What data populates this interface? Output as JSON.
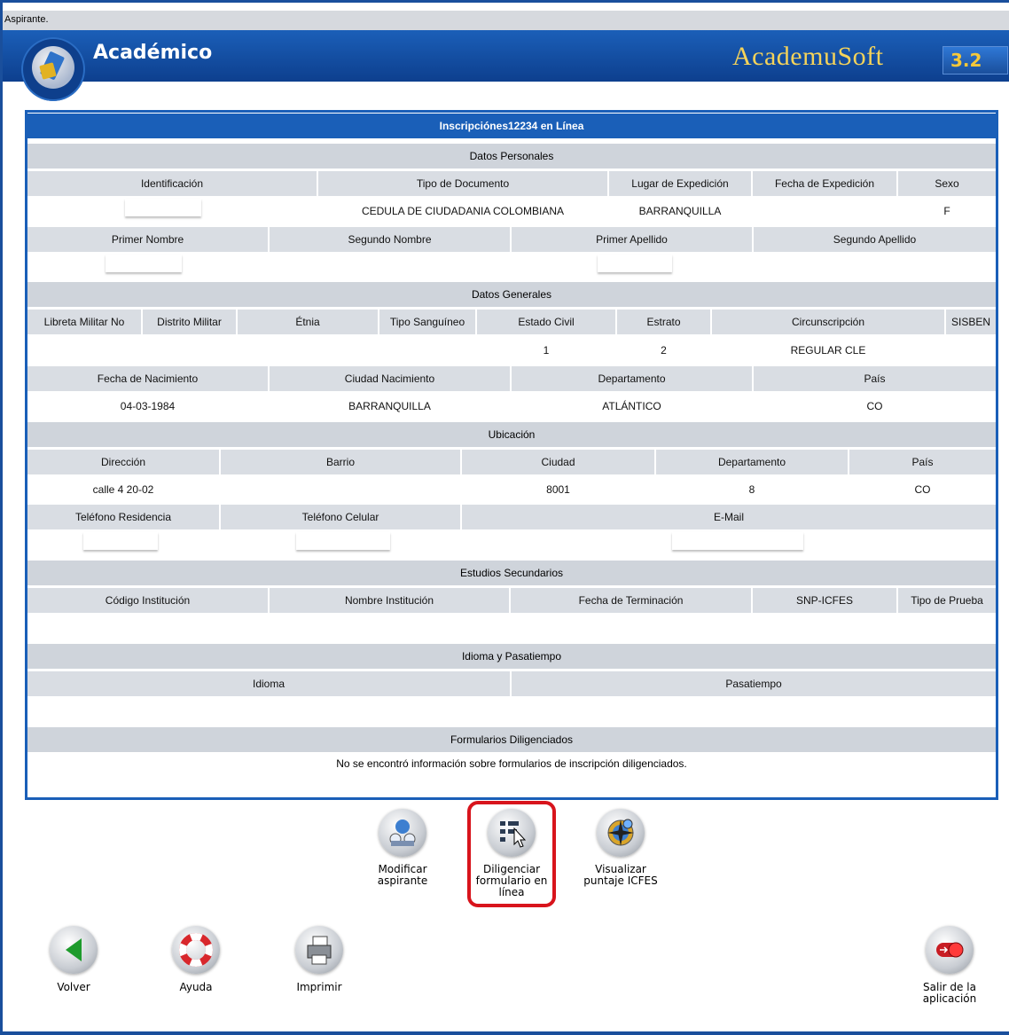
{
  "window": {
    "status_label": "Aspirante."
  },
  "header": {
    "title": "Académico",
    "brand": "AcademuSoft",
    "brand_version": "3.2"
  },
  "panel": {
    "title": "Inscripciónes12234 en Línea",
    "personal": {
      "section": "Datos Personales",
      "h1": [
        "Identificación",
        "Tipo de Documento",
        "Lugar de Expedición",
        "Fecha de Expedición",
        "Sexo"
      ],
      "v1": [
        "",
        "CEDULA DE CIUDADANIA COLOMBIANA",
        "BARRANQUILLA",
        "",
        "F"
      ],
      "h2": [
        "Primer Nombre",
        "Segundo Nombre",
        "Primer Apellido",
        "Segundo Apellido"
      ]
    },
    "general": {
      "section": "Datos Generales",
      "h1": [
        "Libreta Militar No",
        "Distrito Militar",
        "Étnia",
        "Tipo Sanguíneo",
        "Estado Civil",
        "Estrato",
        "Circunscripción",
        "SISBEN"
      ],
      "v1": [
        "",
        "",
        "",
        "",
        "1",
        "2",
        "REGULAR CLE",
        ""
      ],
      "h2": [
        "Fecha de Nacimiento",
        "Ciudad Nacimiento",
        "Departamento",
        "País"
      ],
      "v2": [
        "04-03-1984",
        "BARRANQUILLA",
        "ATLÁNTICO",
        "CO"
      ]
    },
    "location": {
      "section": "Ubicación",
      "h1": [
        "Dirección",
        "Barrio",
        "Ciudad",
        "Departamento",
        "País"
      ],
      "v1": [
        "calle 4 20-02",
        "",
        "8001",
        "8",
        "CO"
      ],
      "h2": [
        "Teléfono Residencia",
        "Teléfono Celular",
        "E-Mail"
      ]
    },
    "secondary": {
      "section": "Estudios Secundarios",
      "h1": [
        "Código Institución",
        "Nombre Institución",
        "Fecha de Terminación",
        "SNP-ICFES",
        "Tipo de Prueba"
      ]
    },
    "language": {
      "section": "Idioma y Pasatiempo",
      "h1": [
        "Idioma",
        "Pasatiempo"
      ]
    },
    "forms": {
      "section": "Formularios Diligenciados",
      "notice": "No se encontró información sobre formularios de inscripción diligenciados."
    }
  },
  "actions": {
    "modificar": "Modificar aspirante",
    "diligenciar": "Diligenciar formulario en línea",
    "visualizar": "Visualizar puntaje ICFES"
  },
  "nav": {
    "volver": "Volver",
    "ayuda": "Ayuda",
    "imprimir": "Imprimir",
    "salir": "Salir de la aplicación"
  },
  "colors": {
    "banner": "#1a5fb8",
    "accent_gold": "#f5d35a",
    "highlight_red": "#d8141c"
  }
}
